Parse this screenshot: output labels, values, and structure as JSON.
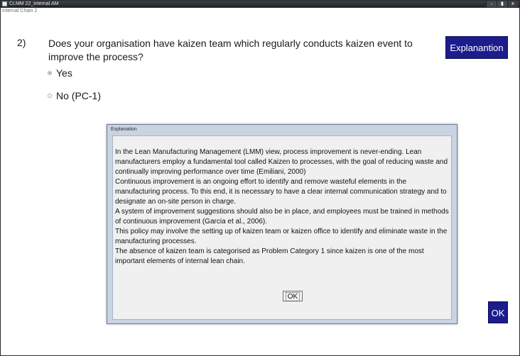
{
  "window": {
    "title": "CLMM 22_internal.AM",
    "subtitle": "Internal Chain 2",
    "controls": {
      "minimize": "–",
      "maximize": "▮",
      "close": "x"
    }
  },
  "question": {
    "number": "2)",
    "text": "Does your organisation have kaizen team which regularly conducts kaizen event to improve the process?",
    "explanation_button": "Explanantion",
    "options": [
      {
        "label": "Yes",
        "selected": true
      },
      {
        "label": "No (PC-1)",
        "selected": false
      }
    ]
  },
  "dialog": {
    "title": "Explanation",
    "paragraphs": [
      "In the Lean Manufacturing Management (LMM) view, process improvement is never-ending. Lean manufacturers employ a fundamental tool called Kaizen to processes, with the goal of reducing waste and continually improving performance over time (Emiliani, 2000)",
      "Continuous improvement is an ongoing effort to identify and remove wasteful elements in the manufacturing process. To this end, it is necessary to have a clear internal communication strategy and to designate an on-site person in charge.",
      "A system of improvement suggestions should also be in place, and employees must be trained in methods of continuous improvement (Garcia et al., 2006).",
      "This policy may involve the setting up of kaizen team or kaizen office to identify and eliminate waste in the manufacturing processes.",
      "The absence of kaizen team is categorised as Problem Category 1 since kaizen is one of the most important elements of internal lean chain."
    ],
    "ok_label": "OK"
  },
  "ok_button": "OK"
}
